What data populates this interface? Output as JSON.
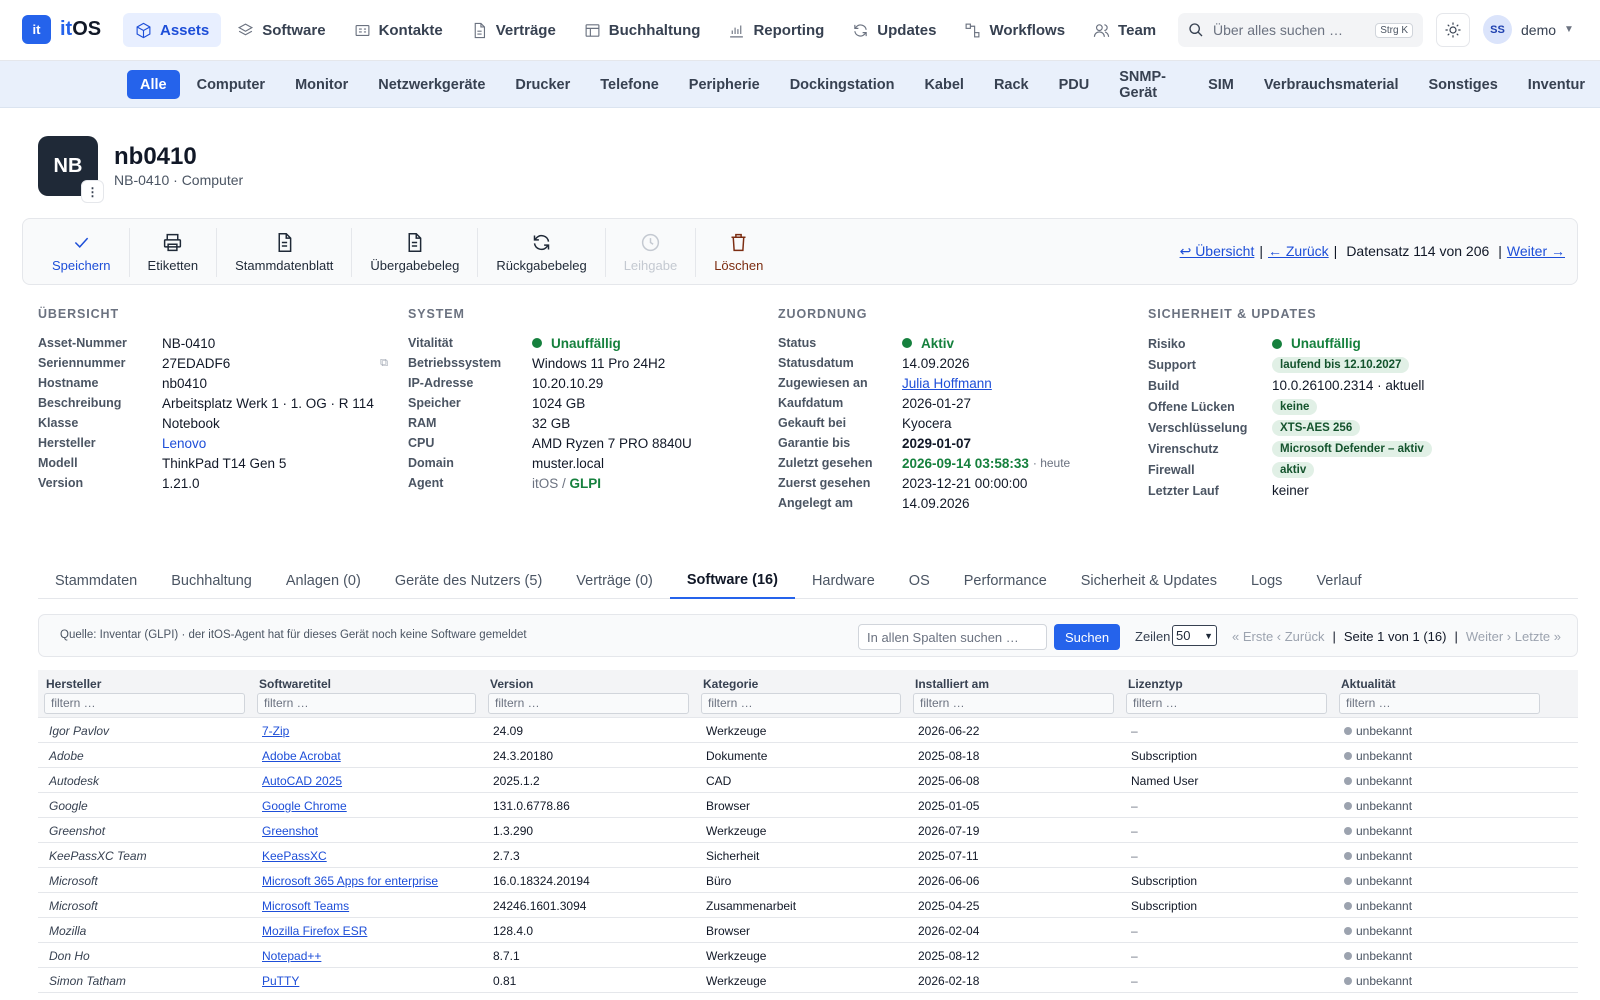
{
  "app": {
    "logo_badge": "it",
    "logo_prefix": "it",
    "logo_suffix": "OS"
  },
  "nav": [
    {
      "label": "Assets",
      "icon": "cube-icon",
      "active": true
    },
    {
      "label": "Software",
      "icon": "layers-icon"
    },
    {
      "label": "Kontakte",
      "icon": "id-card-icon"
    },
    {
      "label": "Verträge",
      "icon": "document-icon"
    },
    {
      "label": "Buchhaltung",
      "icon": "ledger-icon"
    },
    {
      "label": "Reporting",
      "icon": "bar-chart-icon"
    },
    {
      "label": "Updates",
      "icon": "refresh-icon"
    },
    {
      "label": "Workflows",
      "icon": "workflow-icon"
    },
    {
      "label": "Team",
      "icon": "users-icon"
    }
  ],
  "search": {
    "placeholder": "Über alles suchen …",
    "shortcut": "Strg K"
  },
  "user": {
    "initials": "SS",
    "name": "demo"
  },
  "subnav": [
    "Alle",
    "Computer",
    "Monitor",
    "Netzwerkgeräte",
    "Drucker",
    "Telefone",
    "Peripherie",
    "Dockingstation",
    "Kabel",
    "Rack",
    "PDU",
    "SNMP-Gerät",
    "SIM",
    "Verbrauchsmaterial",
    "Sonstiges",
    "Inventur"
  ],
  "asset": {
    "initials": "NB",
    "menu_glyph": "⋮",
    "name": "nb0410",
    "subtitle": "NB-0410 · Computer"
  },
  "toolbar": {
    "save": "Speichern",
    "labels": "Etiketten",
    "master": "Stammdatenblatt",
    "handover": "Übergabebeleg",
    "return": "Rückgabebeleg",
    "loan": "Leihgabe",
    "delete": "Löschen"
  },
  "pager": {
    "overview": "↩ Übersicht",
    "back": "← Zurück",
    "record": "Datensatz 114 von 206",
    "next": "Weiter →",
    "sep": "|"
  },
  "overview": {
    "title": "ÜBERSICHT",
    "rows": [
      {
        "k": "Asset-Nummer",
        "v": "NB-0410"
      },
      {
        "k": "Seriennummer",
        "v": "27EDADF6",
        "copy": "⧉"
      },
      {
        "k": "Hostname",
        "v": "nb0410"
      },
      {
        "k": "Beschreibung",
        "v": "Arbeitsplatz Werk 1 · 1. OG · R 114"
      },
      {
        "k": "Klasse",
        "v": "Notebook"
      },
      {
        "k": "Hersteller",
        "v": "Lenovo"
      },
      {
        "k": "Modell",
        "v": "ThinkPad T14 Gen 5"
      },
      {
        "k": "Version",
        "v": "1.21.0"
      }
    ]
  },
  "system": {
    "title": "SYSTEM",
    "rows": [
      {
        "k": "Vitalität",
        "v": "Unauffällig"
      },
      {
        "k": "Betriebssystem",
        "v": "Windows 11 Pro 24H2"
      },
      {
        "k": "IP-Adresse",
        "v": "10.20.10.29"
      },
      {
        "k": "Speicher",
        "v": "1024 GB"
      },
      {
        "k": "RAM",
        "v": "32 GB"
      },
      {
        "k": "CPU",
        "v": "AMD Ryzen 7 PRO 8840U"
      },
      {
        "k": "Domain",
        "v": "muster.local"
      },
      {
        "k": "Agent",
        "v_a": "itOS",
        "v_sep": " / ",
        "v_b": "GLPI"
      }
    ]
  },
  "assignment": {
    "title": "ZUORDNUNG",
    "rows": [
      {
        "k": "Status",
        "v": "Aktiv"
      },
      {
        "k": "Statusdatum",
        "v": "14.09.2026"
      },
      {
        "k": "Zugewiesen an",
        "v": "Julia Hoffmann"
      },
      {
        "k": "Kaufdatum",
        "v": "2026-01-27"
      },
      {
        "k": "Gekauft bei",
        "v": "Kyocera"
      },
      {
        "k": "Garantie bis",
        "v": "2029-01-07"
      },
      {
        "k": "Zuletzt gesehen",
        "v": "2026-09-14 03:58:33",
        "note": "· heute"
      },
      {
        "k": "Zuerst gesehen",
        "v": "2023-12-21 00:00:00"
      },
      {
        "k": "Angelegt am",
        "v": "14.09.2026"
      }
    ]
  },
  "security": {
    "title": "SICHERHEIT & UPDATES",
    "rows": [
      {
        "k": "Risiko",
        "v": "Unauffällig"
      },
      {
        "k": "Support",
        "v": "laufend bis 12.10.2027"
      },
      {
        "k": "Build",
        "v": "10.0.26100.2314 · aktuell"
      },
      {
        "k": "Offene Lücken",
        "v": "keine"
      },
      {
        "k": "Verschlüsselung",
        "v": "XTS-AES 256"
      },
      {
        "k": "Virenschutz",
        "v": "Microsoft Defender – aktiv"
      },
      {
        "k": "Firewall",
        "v": "aktiv"
      },
      {
        "k": "Letzter Lauf",
        "v": "keiner"
      }
    ]
  },
  "colors": {
    "accent": "#2563eb",
    "ok": "#15803d",
    "dark_tile": "#1f2937"
  },
  "tabs": [
    "Stammdaten",
    "Buchhaltung",
    "Anlagen (0)",
    "Geräte des Nutzers (5)",
    "Verträge (0)",
    "Software (16)",
    "Hardware",
    "OS",
    "Performance",
    "Sicherheit & Updates",
    "Logs",
    "Verlauf"
  ],
  "active_tab": "Software (16)",
  "software": {
    "source_note": "Quelle: Inventar (GLPI) · der itOS-Agent hat für dieses Gerät noch keine Software gemeldet",
    "search_placeholder": "In allen Spalten suchen …",
    "search_button": "Suchen",
    "rows_label": "Zeilen",
    "rows_value": "50",
    "pager_first_prev": "« Erste ‹ Zurück",
    "page_info": "Seite 1 von 1 (16)",
    "pager_next_last": "Weiter › Letzte »",
    "filter_placeholder": "filtern …",
    "columns": [
      "Hersteller",
      "Softwaretitel",
      "Version",
      "Kategorie",
      "Installiert am",
      "Lizenztyp",
      "Aktualität"
    ],
    "rows": [
      [
        "Igor Pavlov",
        "7-Zip",
        "24.09",
        "Werkzeuge",
        "2026-06-22",
        "–",
        "unbekannt"
      ],
      [
        "Adobe",
        "Adobe Acrobat",
        "24.3.20180",
        "Dokumente",
        "2025-08-18",
        "Subscription",
        "unbekannt"
      ],
      [
        "Autodesk",
        "AutoCAD 2025",
        "2025.1.2",
        "CAD",
        "2025-06-08",
        "Named User",
        "unbekannt"
      ],
      [
        "Google",
        "Google Chrome",
        "131.0.6778.86",
        "Browser",
        "2025-01-05",
        "–",
        "unbekannt"
      ],
      [
        "Greenshot",
        "Greenshot",
        "1.3.290",
        "Werkzeuge",
        "2026-07-19",
        "–",
        "unbekannt"
      ],
      [
        "KeePassXC Team",
        "KeePassXC",
        "2.7.3",
        "Sicherheit",
        "2025-07-11",
        "–",
        "unbekannt"
      ],
      [
        "Microsoft",
        "Microsoft 365 Apps for enterprise",
        "16.0.18324.20194",
        "Büro",
        "2026-06-06",
        "Subscription",
        "unbekannt"
      ],
      [
        "Microsoft",
        "Microsoft Teams",
        "24246.1601.3094",
        "Zusammenarbeit",
        "2025-04-25",
        "Subscription",
        "unbekannt"
      ],
      [
        "Mozilla",
        "Mozilla Firefox ESR",
        "128.4.0",
        "Browser",
        "2026-02-04",
        "–",
        "unbekannt"
      ],
      [
        "Don Ho",
        "Notepad++",
        "8.7.1",
        "Werkzeuge",
        "2025-08-12",
        "–",
        "unbekannt"
      ],
      [
        "Simon Tatham",
        "PuTTY",
        "0.81",
        "Werkzeuge",
        "2026-02-18",
        "–",
        "unbekannt"
      ]
    ]
  }
}
